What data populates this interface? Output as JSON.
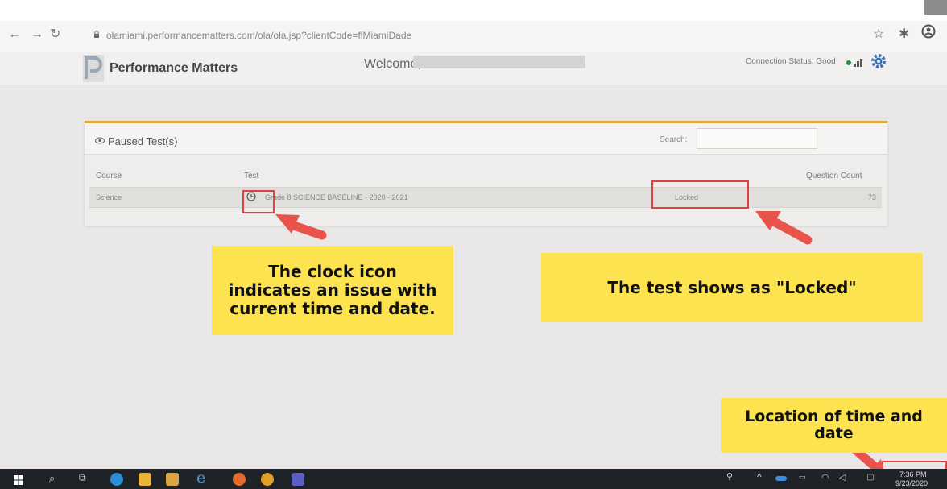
{
  "browser": {
    "url": "olamiami.performancematters.com/ola/ola.jsp?clientCode=flMiamiDade",
    "back_icon": "arrow-left-icon",
    "forward_icon": "arrow-right-icon",
    "reload_icon": "reload-icon"
  },
  "header": {
    "app_name": "Performance Matters",
    "welcome": "Welcome,",
    "connection_status": "Connection Status: Good",
    "status_color": "#2b8a3e"
  },
  "panel": {
    "title": "Paused Test(s)",
    "search_label": "Search:",
    "search_value": "",
    "columns": {
      "course": "Course",
      "test": "Test",
      "question_count": "Question Count"
    },
    "rows": [
      {
        "course": "Science",
        "test": "Grade 8 SCIENCE BASELINE - 2020 - 2021",
        "status": "Locked",
        "question_count": "73"
      }
    ]
  },
  "annotations": {
    "clock_note": "The clock icon indicates an issue with current time and date.",
    "locked_note": "The test shows as \"Locked\"",
    "time_note": "Location of time and date"
  },
  "taskbar": {
    "time": "7:36 PM",
    "date": "9/23/2020"
  },
  "colors": {
    "accent": "#e0a83c",
    "callout": "#fde34f",
    "highlight": "#e0403f",
    "arrow": "#e8534b"
  }
}
